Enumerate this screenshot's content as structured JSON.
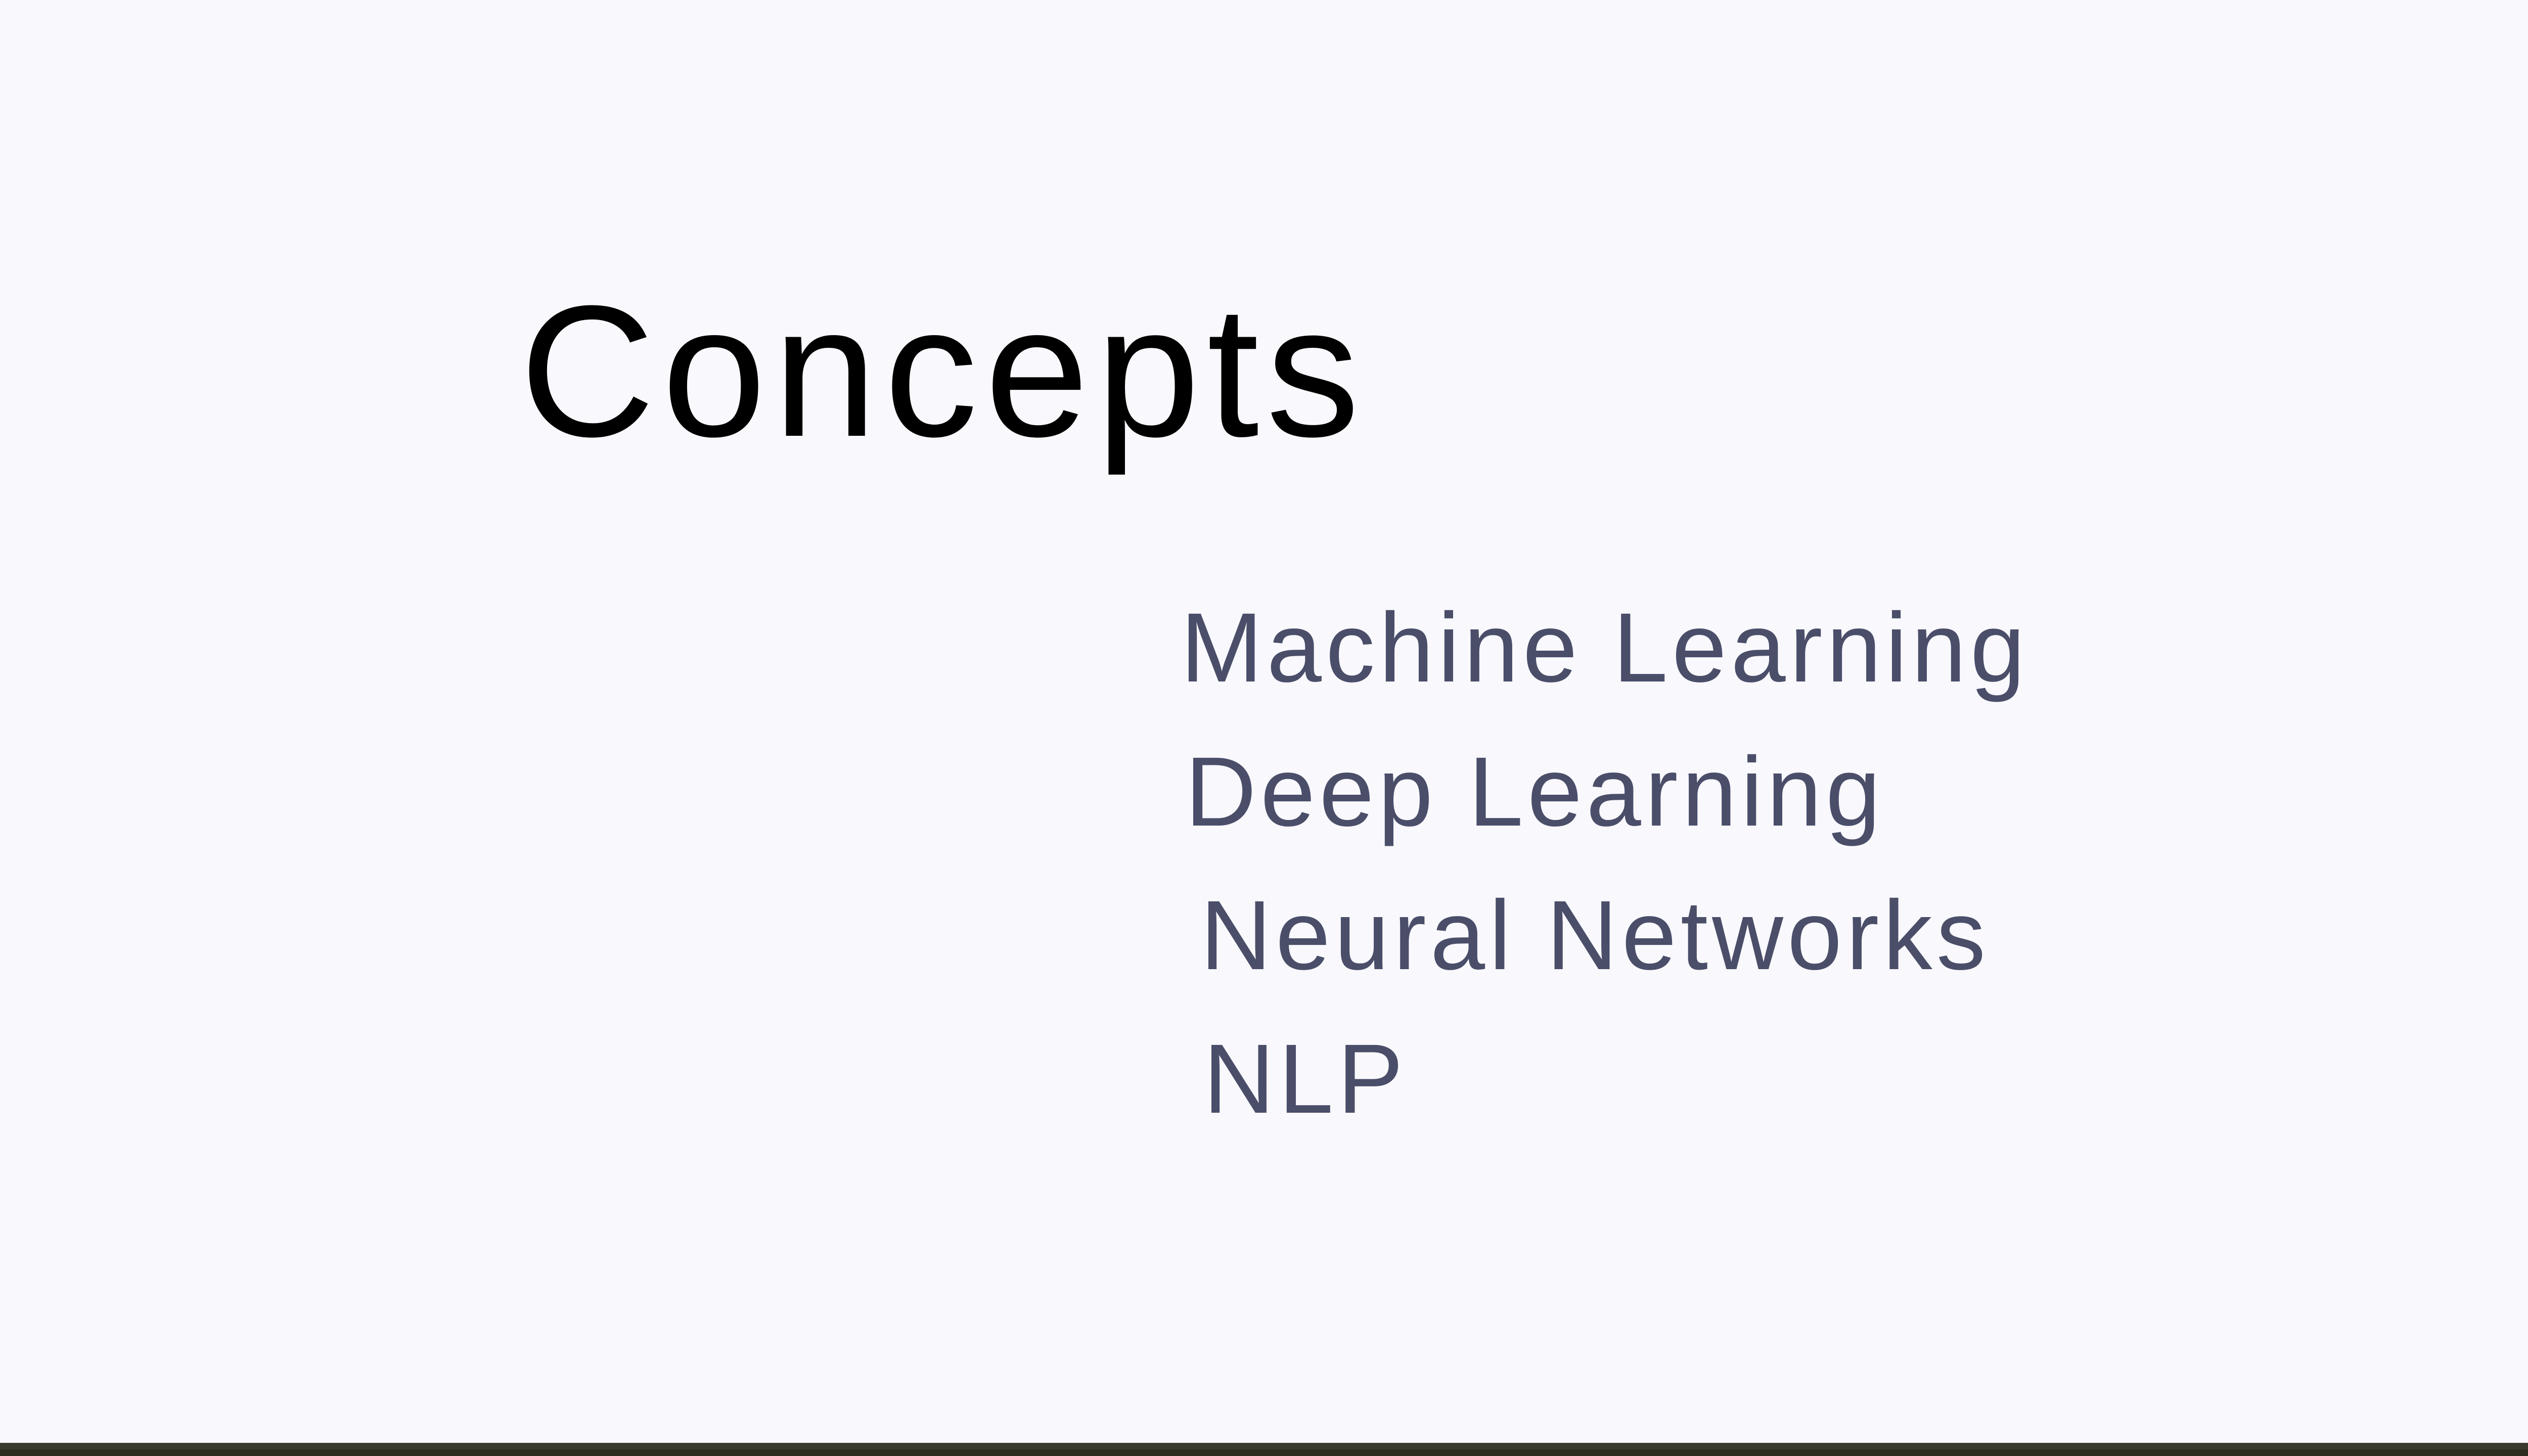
{
  "slide": {
    "title": "Concepts",
    "items": [
      "Machine Learning",
      "Deep Learning",
      "Neural Networks",
      "NLP"
    ]
  },
  "colors": {
    "background": "#f8f8fd",
    "title": "#000000",
    "items": "#4a4e69",
    "bottom_bar": "#2e2d21"
  }
}
